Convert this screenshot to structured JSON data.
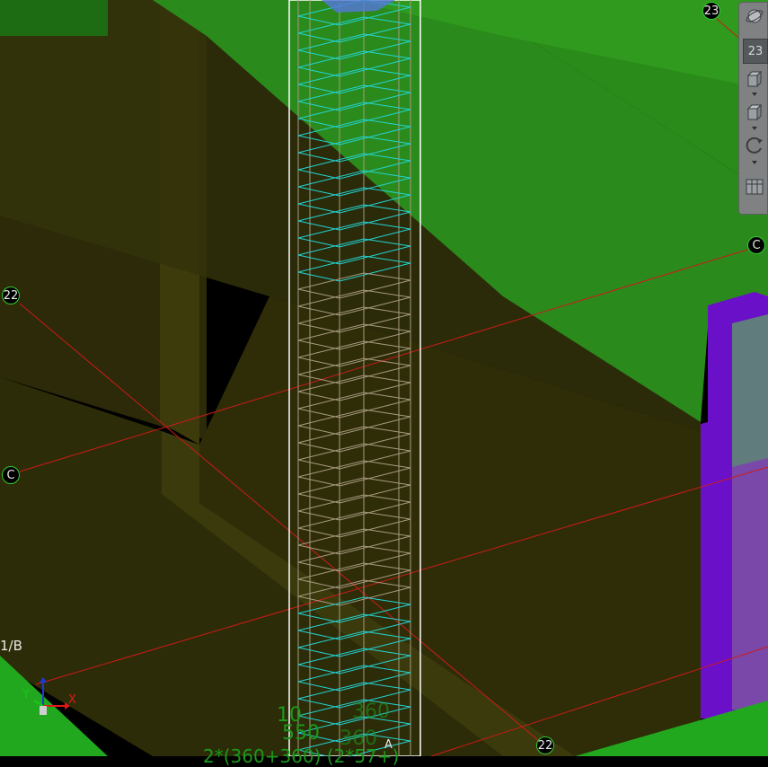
{
  "viewport": {
    "grid_labels": {
      "top_right_23": "23",
      "toolbar_23": "23",
      "right_c": "C",
      "left_22": "22",
      "left_c": "C",
      "left_1b": "1/B",
      "bottom_22": "22",
      "bottom_a": "A"
    },
    "dimension_text": {
      "line1a": "10",
      "line1b": "360",
      "line2a": "550",
      "line2b": "360",
      "line3": "2*(360+360) (2*57+)"
    },
    "axis": {
      "x_label": "X",
      "y_label": "Y"
    }
  },
  "toolbar": {
    "buttons": [
      {
        "name": "orbit-button"
      },
      {
        "name": "view-cube-button"
      },
      {
        "name": "box-view-button"
      },
      {
        "name": "rotate-button"
      },
      {
        "name": "view-settings-button"
      }
    ]
  },
  "colors": {
    "background": "#000000",
    "slab_green": "#2a8a1a",
    "wall_olive": "#3a3a08",
    "grid_red": "#cc1a1a",
    "rebar_cyan": "#22d4d4",
    "rebar_tan": "#a89a80",
    "column_purple": "#6a10c8",
    "bubble_border": "#33cc33"
  }
}
